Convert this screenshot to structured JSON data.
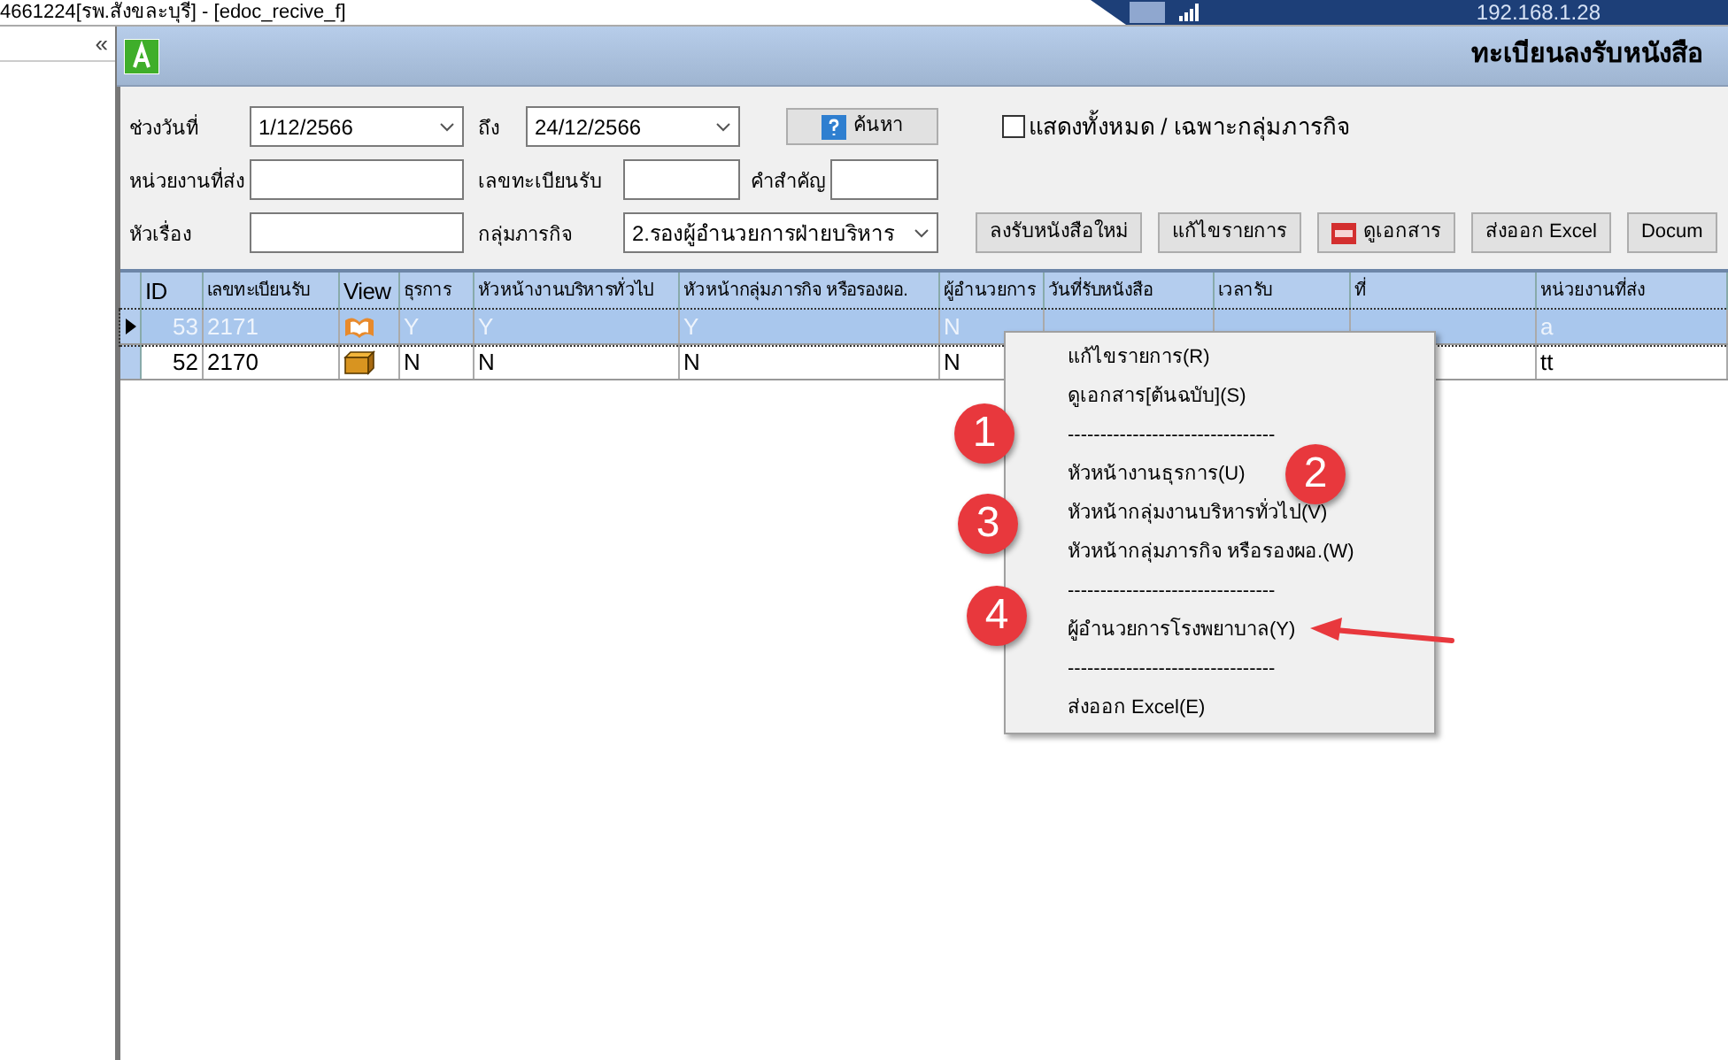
{
  "window": {
    "title": "4661224[รพ.สังขละบุรี] - [edoc_recive_f]"
  },
  "remote_bar": {
    "address": "192.168.1.28"
  },
  "sidebar": {
    "collapse": "«"
  },
  "header": {
    "title": "ทะเบียนลงรับหนังสือ"
  },
  "filters": {
    "date_range_label": "ช่วงวันที่",
    "date_from": "1/12/2566",
    "to_label": "ถึง",
    "date_to": "24/12/2566",
    "search_button": "ค้นหา",
    "show_all": {
      "label": "แสดงทั้งหมด / เฉพาะกลุ่มภารกิจ",
      "checked": false
    },
    "sender_label": "หน่วยงานที่ส่ง",
    "reg_no_label": "เลขทะเบียนรับ",
    "keyword_label": "คำสำคัญ",
    "subject_label": "หัวเรื่อง",
    "group_label": "กลุ่มภารกิจ",
    "group_value": "2.รองผู้อำนวยการฝ่ายบริหาร"
  },
  "actions": [
    {
      "label": "ลงรับหนังสือใหม่",
      "kind": "plain"
    },
    {
      "label": "แก้ไขรายการ",
      "kind": "plain"
    },
    {
      "label": "ดูเอกสาร",
      "kind": "pdf"
    },
    {
      "label": "ส่งออก Excel",
      "kind": "plain"
    },
    {
      "label": "Docum",
      "kind": "plain"
    }
  ],
  "table": {
    "columns": [
      "ID",
      "เลขทะเบียนรับ",
      "View",
      "ธุรการ",
      "หัวหน้างานบริหารทั่วไป",
      "หัวหน้ากลุ่มภารกิจ หรือรองผอ.",
      "ผู้อำนวยการ",
      "วันที่รับหนังสือ",
      "เวลารับ",
      "ที่",
      "หน่วยงานที่ส่ง"
    ],
    "rows": [
      {
        "selected": true,
        "kind": "book",
        "cells": [
          "53",
          "2171",
          null,
          "Y",
          "Y",
          "Y",
          "N",
          null,
          null,
          null,
          "a"
        ]
      },
      {
        "selected": false,
        "kind": "box",
        "cells": [
          "52",
          "2170",
          null,
          "N",
          "N",
          "N",
          "N",
          null,
          null,
          null,
          "tt"
        ]
      }
    ]
  },
  "context_menu": {
    "items": [
      "แก้ไขรายการ(R)",
      "ดูเอกสาร[ต้นฉบับ](S)",
      "--------------------------------",
      "หัวหน้างานธุรการ(U)",
      "หัวหน้ากลุ่มงานบริหารทั่วไป(V)",
      "หัวหน้ากลุ่มภารกิจ หรือรองผอ.(W)",
      "--------------------------------",
      "ผู้อำนวยการโรงพยาบาล(Y)",
      "--------------------------------",
      "ส่งออก Excel(E)"
    ]
  },
  "annotations": [
    {
      "label": "1"
    },
    {
      "label": "2"
    },
    {
      "label": "3"
    },
    {
      "label": "4"
    }
  ]
}
